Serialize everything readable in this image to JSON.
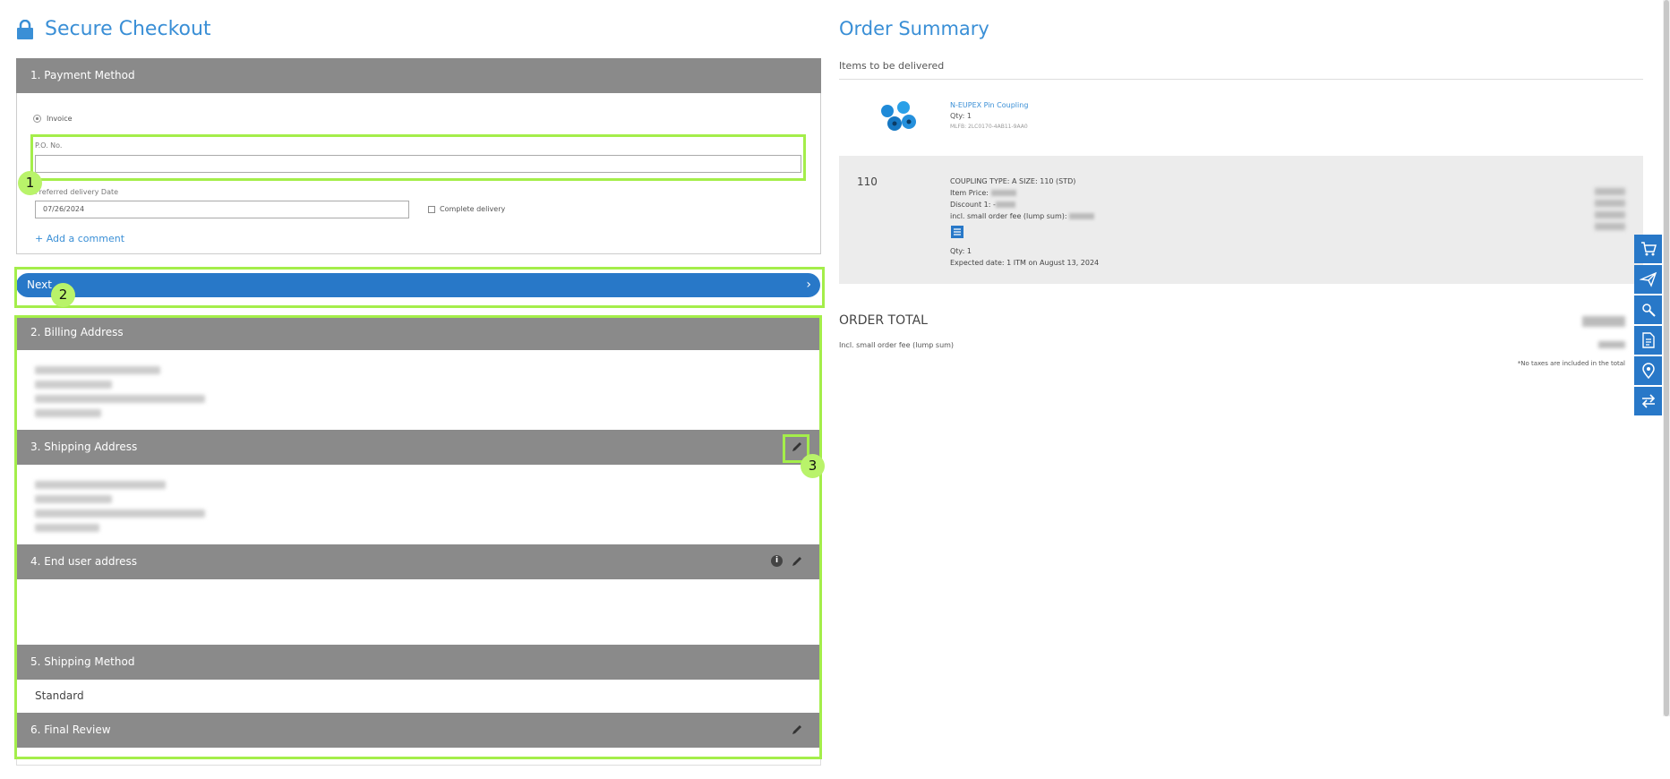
{
  "checkout": {
    "title": "Secure Checkout",
    "payment": {
      "header": "1. Payment Method",
      "invoice_label": "Invoice",
      "po_label": "P.O. No.",
      "po_value": "",
      "preferred_date_label": "Preferred delivery Date",
      "preferred_date_value": "07/26/2024",
      "complete_delivery_label": "Complete delivery",
      "add_comment": "+ Add a comment"
    },
    "next_label": "Next",
    "billing_header": "2. Billing Address",
    "shipping_header": "3. Shipping Address",
    "end_user_header": "4. End user address",
    "shipping_method_header": "5. Shipping Method",
    "shipping_method_value": "Standard",
    "final_review_header": "6. Final Review"
  },
  "annotations": [
    "1",
    "2",
    "3"
  ],
  "summary": {
    "title": "Order Summary",
    "items_label": "Items to be delivered",
    "product": {
      "name": "N-EUPEX Pin Coupling",
      "qty": "Qty:  1",
      "mlfb": "MLFB: 2LC0170-4AB11-9AA0"
    },
    "line": {
      "num": "110",
      "desc": "COUPLING TYPE: A SIZE: 110 (STD)",
      "item_price": "Item Price:",
      "discount": "Discount 1: -",
      "fee": "incl. small order fee (lump sum):",
      "qty": "Qty:  1",
      "expected": "Expected date:  1 ITM on August 13, 2024"
    },
    "order_total": "ORDER TOTAL",
    "incl_fee": "Incl. small order fee (lump sum)",
    "no_taxes": "*No taxes are included in the total"
  },
  "colors": {
    "accent": "#2878c8",
    "header_grey": "#8a8a8a",
    "highlight": "#a4ee4a"
  }
}
